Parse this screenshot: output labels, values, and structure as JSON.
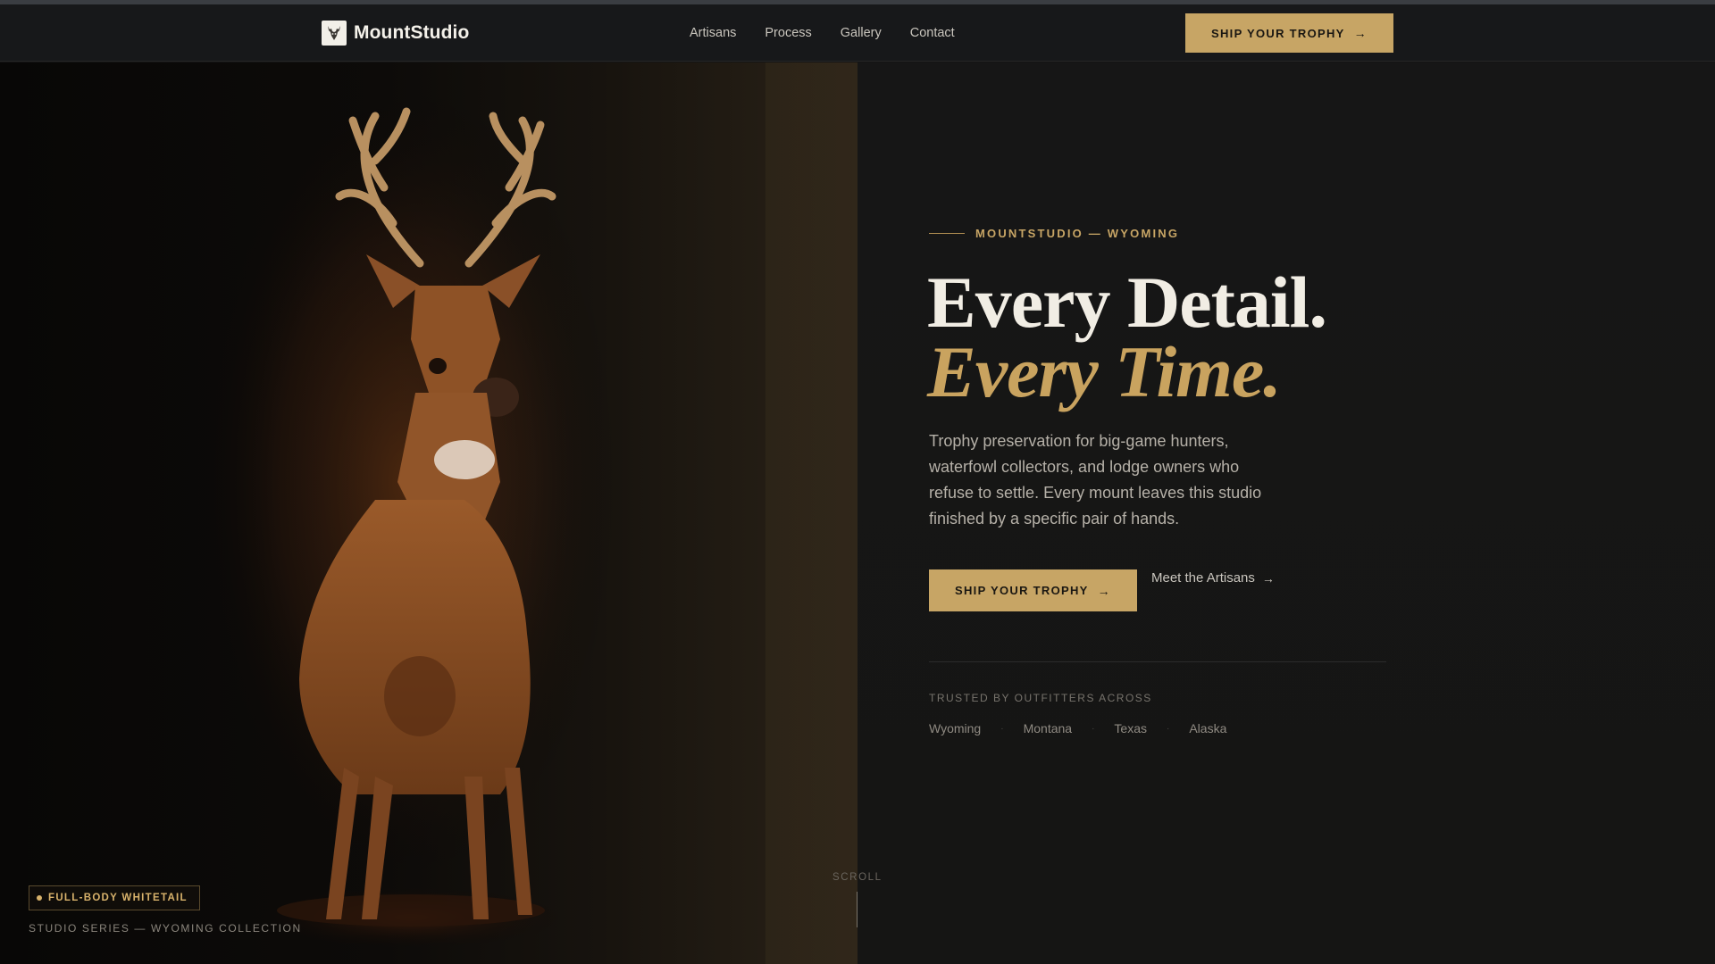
{
  "brand": {
    "name": "MountStudio",
    "logo_icon": "deer-head-icon"
  },
  "nav": {
    "links": [
      "Artisans",
      "Process",
      "Gallery",
      "Contact"
    ],
    "cta": "SHIP YOUR TROPHY"
  },
  "hero": {
    "eyebrow": "MOUNTSTUDIO — WYOMING",
    "headline_1": "Every Detail.",
    "headline_2": "Every Time.",
    "lede": "Trophy preservation for big-game hunters, waterfowl collectors, and lodge owners who refuse to settle. Every mount leaves this studio finished by a specific pair of hands.",
    "cta_primary": "SHIP YOUR TROPHY",
    "cta_secondary": "Meet the Artisans",
    "trusted_label": "TRUSTED BY OUTFITTERS ACROSS",
    "regions": [
      "Wyoming",
      "Montana",
      "Texas",
      "Alaska"
    ]
  },
  "feature": {
    "tag": "FULL-BODY WHITETAIL",
    "series": "STUDIO SERIES — WYOMING COLLECTION"
  },
  "scroll_label": "SCROLL",
  "colors": {
    "accent": "#c7a565",
    "background": "#141414",
    "text": "#f1ede4"
  }
}
